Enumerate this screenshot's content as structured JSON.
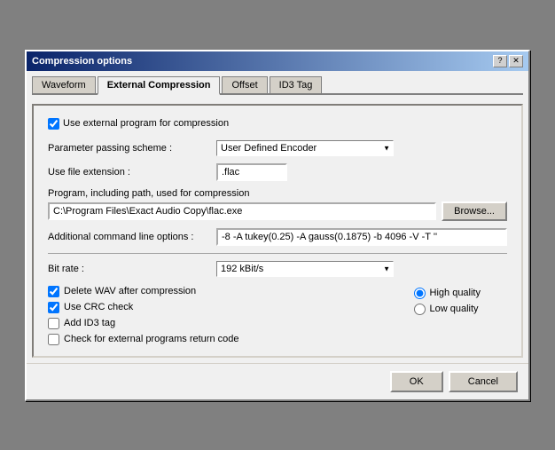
{
  "dialog": {
    "title": "Compression options"
  },
  "title_buttons": {
    "help": "?",
    "close": "✕"
  },
  "tabs": [
    {
      "id": "waveform",
      "label": "Waveform",
      "active": false
    },
    {
      "id": "external-compression",
      "label": "External Compression",
      "active": true
    },
    {
      "id": "offset",
      "label": "Offset",
      "active": false
    },
    {
      "id": "id3tag",
      "label": "ID3 Tag",
      "active": false
    }
  ],
  "use_external": {
    "label": "Use external program for compression",
    "checked": true
  },
  "parameter_scheme": {
    "label": "Parameter passing scheme :",
    "value": "User Defined Encoder"
  },
  "file_extension": {
    "label": "Use file extension :",
    "value": ".flac"
  },
  "program_path": {
    "label": "Program, including path, used for compression",
    "value": "C:\\Program Files\\Exact Audio Copy\\flac.exe",
    "browse_label": "Browse..."
  },
  "additional_options": {
    "label": "Additional command line options :",
    "value": "-8 -A tukey(0.25) -A gauss(0.1875) -b 4096 -V -T ''"
  },
  "bitrate": {
    "label": "Bit rate :",
    "value": "192 kBit/s"
  },
  "checkboxes": [
    {
      "id": "delete-wav",
      "label": "Delete WAV after compression",
      "checked": true
    },
    {
      "id": "use-crc",
      "label": "Use CRC check",
      "checked": true
    },
    {
      "id": "add-id3",
      "label": "Add ID3 tag",
      "checked": false
    },
    {
      "id": "check-return",
      "label": "Check for external programs return code",
      "checked": false
    }
  ],
  "radios": [
    {
      "id": "high-quality",
      "label": "High quality",
      "checked": true
    },
    {
      "id": "low-quality",
      "label": "Low quality",
      "checked": false
    }
  ],
  "footer": {
    "ok_label": "OK",
    "cancel_label": "Cancel"
  }
}
